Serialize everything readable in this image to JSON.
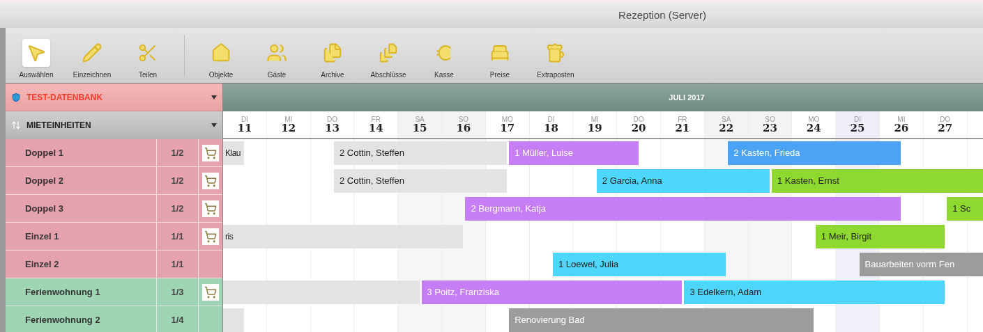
{
  "window": {
    "title": "Rezeption (Server)"
  },
  "tools": [
    {
      "label": "Auswählen",
      "selected": true,
      "kind": "pointer"
    },
    {
      "label": "Einzeichnen",
      "selected": false,
      "kind": "pencil"
    },
    {
      "label": "Teilen",
      "selected": false,
      "kind": "scissors"
    }
  ],
  "modules": [
    {
      "label": "Objekte",
      "kind": "house"
    },
    {
      "label": "Gäste",
      "kind": "users"
    },
    {
      "label": "Archive",
      "kind": "files"
    },
    {
      "label": "Abschlüsse",
      "kind": "euro-files"
    },
    {
      "label": "Kasse",
      "kind": "ruler"
    },
    {
      "label": "Preise",
      "kind": "bed"
    },
    {
      "label": "Extraposten",
      "kind": "beer"
    }
  ],
  "sidebar": {
    "database": "TEST-DATENBANK",
    "list_header": "MIETEINHEITEN"
  },
  "calendar": {
    "month": "JULI 2017",
    "days": [
      {
        "weekday": "DI",
        "day": "11",
        "weekend": false,
        "today": false
      },
      {
        "weekday": "MI",
        "day": "12",
        "weekend": false,
        "today": false
      },
      {
        "weekday": "DO",
        "day": "13",
        "weekend": false,
        "today": false
      },
      {
        "weekday": "FR",
        "day": "14",
        "weekend": false,
        "today": false
      },
      {
        "weekday": "SA",
        "day": "15",
        "weekend": true,
        "today": false
      },
      {
        "weekday": "SO",
        "day": "16",
        "weekend": true,
        "today": false
      },
      {
        "weekday": "MO",
        "day": "17",
        "weekend": false,
        "today": false
      },
      {
        "weekday": "DI",
        "day": "18",
        "weekend": false,
        "today": false
      },
      {
        "weekday": "MI",
        "day": "19",
        "weekend": false,
        "today": false
      },
      {
        "weekday": "DO",
        "day": "20",
        "weekend": false,
        "today": false
      },
      {
        "weekday": "FR",
        "day": "21",
        "weekend": false,
        "today": false
      },
      {
        "weekday": "SA",
        "day": "22",
        "weekend": true,
        "today": false
      },
      {
        "weekday": "SO",
        "day": "23",
        "weekend": true,
        "today": false
      },
      {
        "weekday": "MO",
        "day": "24",
        "weekend": false,
        "today": false
      },
      {
        "weekday": "DI",
        "day": "25",
        "weekend": false,
        "today": true
      },
      {
        "weekday": "MI",
        "day": "26",
        "weekend": false,
        "today": false
      },
      {
        "weekday": "DO",
        "day": "27",
        "weekend": false,
        "today": false
      }
    ]
  },
  "units": [
    {
      "name": "Doppel 1",
      "count": "1/2",
      "has_icon": true,
      "color": "#e3a2ad",
      "bookings": [
        {
          "label": "Klau",
          "color": "#e3e3e3"
        },
        {
          "label": "2 Cottin, Steffen",
          "color": "#e3e3e3"
        },
        {
          "label": "1 Müller, Luise",
          "color": "#c77df5"
        },
        {
          "label": "2 Kasten, Frieda",
          "color": "#4aa3f5"
        }
      ]
    },
    {
      "name": "Doppel 2",
      "count": "1/2",
      "has_icon": true,
      "color": "#e3a2ad",
      "bookings": [
        {
          "label": "2 Cottin, Steffen",
          "color": "#e3e3e3"
        },
        {
          "label": "2 Garcia, Anna",
          "color": "#4dd6fa"
        },
        {
          "label": "1 Kasten, Ernst",
          "color": "#8fd830"
        }
      ]
    },
    {
      "name": "Doppel 3",
      "count": "1/2",
      "has_icon": true,
      "color": "#e3a2ad",
      "bookings": [
        {
          "label": "2 Bergmann, Katja",
          "color": "#c77df5"
        },
        {
          "label": "1 Sc",
          "color": "#8fd830"
        }
      ]
    },
    {
      "name": "Einzel 1",
      "count": "1/1",
      "has_icon": true,
      "color": "#e3a2ad",
      "bookings": [
        {
          "label": "ris",
          "color": "#e3e3e3"
        },
        {
          "label": "1 Meir, Birgit",
          "color": "#8fd830"
        }
      ]
    },
    {
      "name": "Einzel 2",
      "count": "1/1",
      "has_icon": false,
      "color": "#e3a2ad",
      "bookings": [
        {
          "label": "1 Loewel, Julia",
          "color": "#4dd6fa"
        },
        {
          "label": "Bauarbeiten vorm Fen",
          "color": "#9c9c9c"
        }
      ]
    },
    {
      "name": "Ferienwohnung 1",
      "count": "1/3",
      "has_icon": true,
      "color": "#9fd4b4",
      "bookings": [
        {
          "color": "#e3e3e3"
        },
        {
          "label": "3 Poitz, Franziska",
          "color": "#c77df5"
        },
        {
          "label": "3 Edelkern, Adam",
          "color": "#4dd6fa"
        }
      ]
    },
    {
      "name": "Ferienwohnung 2",
      "count": "1/4",
      "has_icon": false,
      "color": "#9fd4b4",
      "bookings": [
        {
          "color": "#e3e3e3"
        },
        {
          "label": "Renovierung Bad",
          "color": "#9c9c9c"
        }
      ]
    }
  ]
}
